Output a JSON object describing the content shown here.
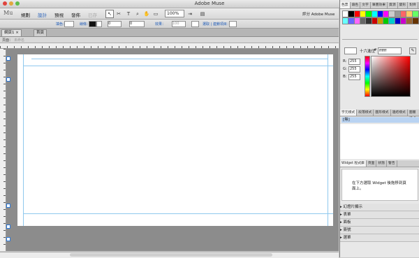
{
  "window": {
    "title": "Adobe Muse"
  },
  "menubar": {
    "logo": "Mu",
    "items": [
      "規劃",
      "設計",
      "預視",
      "發佈"
    ],
    "dimmed": "已存",
    "zoom": "100%",
    "rating": "評分 Adobe Muse"
  },
  "options": {
    "page_label": "頁面：",
    "page_value": "未命名",
    "fill_label": "填色：",
    "stroke_label": "線條：",
    "stroke_value": "0",
    "wrap_value": "0",
    "effect_label": "效果：",
    "opacity_value": "100",
    "rotate_label": "選取 | 連鎖項目：",
    "extra_label": "當實際資料："
  },
  "tabs": {
    "main": "網頁1",
    "page": "首頁"
  },
  "panels": {
    "color_tabs": [
      "色票",
      "填色",
      "文字",
      "筆畫效果",
      "資源",
      "變形",
      "對齊"
    ],
    "swatches": [
      "#ffffff",
      "#000000",
      "#ff0000",
      "#ffff00",
      "#00ff00",
      "#00ffff",
      "#0000ff",
      "#ff00ff",
      "#cccccc",
      "#999999",
      "#ff6666",
      "#ffcc66",
      "#66ff66",
      "#66ffff",
      "#6666ff",
      "#ff66ff",
      "#666666",
      "#333333",
      "#cc0000",
      "#cc9900",
      "#00cc00",
      "#00cccc",
      "#0000cc",
      "#cc00cc",
      "#996633",
      "#663300"
    ],
    "hex_label": "十六進位",
    "hex_value": "ffffff",
    "rgb": [
      {
        "label": "R:",
        "value": "255"
      },
      {
        "label": "G:",
        "value": "255"
      },
      {
        "label": "B:",
        "value": "255"
      }
    ],
    "style_tabs": [
      "字元樣式",
      "段落樣式",
      "圖形樣式",
      "連結樣式",
      "圖層樣式"
    ],
    "style_item": "[無]",
    "widget_tabs": [
      "Widget 程式庫",
      "頁面",
      "狀態",
      "警告"
    ],
    "widget_msg": "在下方選取 Widget 後拖移到頁面上。",
    "accordion": [
      "幻燈片顯示",
      "表單",
      "面板",
      "簽號",
      "選單"
    ]
  }
}
